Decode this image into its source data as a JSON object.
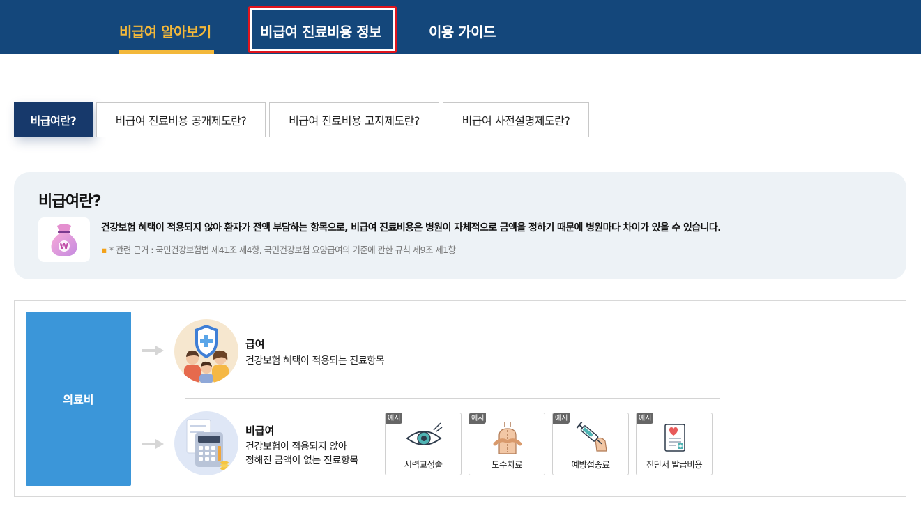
{
  "nav": {
    "items": [
      {
        "label": "비급여 알아보기"
      },
      {
        "label": "비급여 진료비용 정보"
      },
      {
        "label": "이용 가이드"
      }
    ]
  },
  "subtabs": [
    {
      "label": "비급여란?"
    },
    {
      "label": "비급여 진료비용 공개제도란?"
    },
    {
      "label": "비급여 진료비용 고지제도란?"
    },
    {
      "label": "비급여 사전설명제도란?"
    }
  ],
  "definition": {
    "title": "비급여란?",
    "text": "건강보험 혜택이 적용되지 않아 환자가 전액 부담하는 항목으로, 비급여 진료비용은 병원이 자체적으로 금액을 정하기 때문에 병원마다 차이가 있을 수 있습니다.",
    "note": "* 관련 근거 : 국민건강보험법 제41조 제4항, 국민건강보험 요양급여의 기준에 관한 규칙 제9조 제1항",
    "icon": "money-bag-icon"
  },
  "diagram": {
    "root_label": "의료비",
    "covered": {
      "title": "급여",
      "desc": "건강보험 혜택이 적용되는 진료항목"
    },
    "uncovered": {
      "title": "비급여",
      "desc_line1": "건강보험이 적용되지 않아",
      "desc_line2": "정해진 금액이 없는 진료항목"
    },
    "examples": [
      {
        "tag": "예시",
        "label": "시력교정술",
        "icon": "eye-icon"
      },
      {
        "tag": "예시",
        "label": "도수치료",
        "icon": "back-therapy-icon"
      },
      {
        "tag": "예시",
        "label": "예방접종료",
        "icon": "syringe-icon"
      },
      {
        "tag": "예시",
        "label": "진단서 발급비용",
        "icon": "certificate-icon"
      }
    ]
  },
  "colors": {
    "nav_bg": "#14477b",
    "nav_active": "#f3b83a",
    "highlight": "#e0141c",
    "tab_active": "#17396b",
    "root_box": "#3b96d9"
  }
}
